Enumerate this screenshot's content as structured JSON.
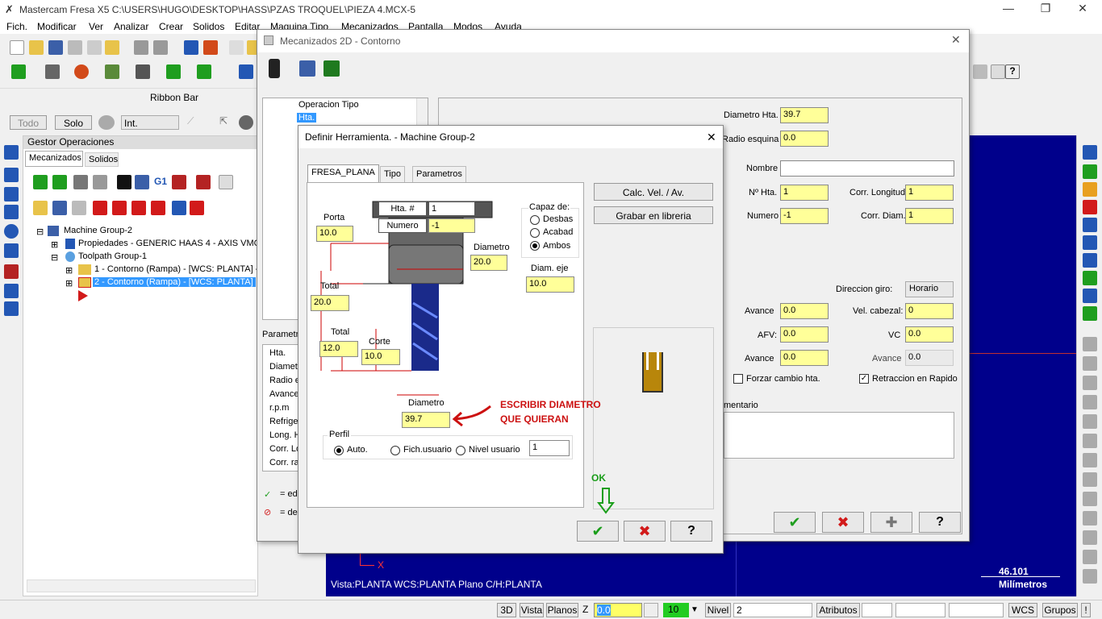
{
  "app": {
    "logo_glyph": "✗",
    "title": "Mastercam Fresa X5  C:\\USERS\\HUGO\\DESKTOP\\HASS\\PZAS TROQUEL\\PIEZA 4.MCX-5",
    "minimize": "—",
    "restore": "❐",
    "close": "✕"
  },
  "menu": [
    "Fich.",
    "Modificar",
    "Ver",
    "Analizar",
    "Crear",
    "Solidos",
    "Editar",
    "Maquina Tipo",
    "Mecanizados",
    "Pantalla",
    "Modos",
    "Ayuda"
  ],
  "ribbon_label": "Ribbon Bar",
  "filter": {
    "todo": "Todo",
    "solo": "Solo",
    "int": "Int."
  },
  "ops": {
    "header": "Gestor Operaciones",
    "tab1": "Mecanizados",
    "tab2": "Solidos",
    "g1": "G1",
    "tree": [
      "Machine Group-2",
      "Propiedades - GENERIC HAAS 4 - AXIS VMC",
      "Toolpath Group-1",
      "1 - Contorno  (Rampa) - [WCS: PLANTA] -",
      "2 - Contorno  (Rampa) - [WCS: PLANTA] -"
    ]
  },
  "viewport": {
    "x_label": "X",
    "status": "Vista:PLANTA   WCS:PLANTA   Plano C/H:PLANTA",
    "scale_value": "46.101",
    "scale_units": "Milímetros"
  },
  "statusbar": {
    "b3d": "3D",
    "vista": "Vista",
    "planos": "Planos",
    "z": "Z",
    "z_val": "0.0",
    "color": "10",
    "nivel": "Nivel",
    "nivel_val": "2",
    "atributos": "Atributos",
    "wcs": "WCS",
    "grupos": "Grupos",
    "bang": "!"
  },
  "contorno": {
    "title": "Mecanizados 2D - Contorno",
    "tree": [
      "Operacion Tipo",
      "Hta."
    ],
    "param_label": "Parametro",
    "param_items": [
      "Hta.",
      "Diametr",
      "Radio e",
      "Avance",
      "r.p.m",
      "Refriger",
      "Long. H",
      "Corr. Lo",
      "Corr. rad"
    ],
    "legend1": "= ed",
    "legend2": "= de",
    "diam_label": "Diametro Hta.",
    "diam_val": "39.7",
    "radio_label": "Radio esquina",
    "radio_val": "0.0",
    "nombre_label": "Nombre",
    "nhta_label": "Nº Hta.",
    "nhta_val": "1",
    "corrlong_label": "Corr. Longitud",
    "corrlong_val": "1",
    "numero_label": "Numero",
    "numero_val": "-1",
    "corrdiam_label": "Corr. Diam.",
    "corrdiam_val": "1",
    "dirgiro_label": "Direccion giro:",
    "dirgiro_val": "Horario",
    "avance_label": "Avance",
    "avance_val": "0.0",
    "velcab_label": "Vel. cabezal:",
    "velcab_val": "0",
    "afv_label": "AFV:",
    "afv_val": "0.0",
    "vc_label": "VC",
    "vc_val": "0.0",
    "avance2_label": "Avance",
    "avance2_val": "0.0",
    "avance3_label": "Avance",
    "avance3_val": "0.0",
    "forzar_label": "Forzar cambio hta.",
    "retraccion_label": "Retraccion en Rapido",
    "comentario_label": "mentario"
  },
  "herramienta": {
    "title": "Definir Herramienta. - Machine Group-2",
    "tabs": [
      "FRESA_PLANA",
      "Tipo",
      "Parametros"
    ],
    "hta_label": "Hta. #",
    "hta_val": "1",
    "numero_label": "Numero",
    "numero_val": "-1",
    "porta_label": "Porta",
    "porta_val": "10.0",
    "diametro_label": "Diametro",
    "diametro_val": "20.0",
    "diam_eje_label": "Diam. eje",
    "diam_eje_val": "10.0",
    "total_label": "Total",
    "total_val": "20.0",
    "total2_label": "Total",
    "total2_val": "12.0",
    "corte_label": "Corte",
    "corte_val": "10.0",
    "diam_bottom_label": "Diametro",
    "diam_bottom_val": "39.7",
    "capaz_label": "Capaz de:",
    "capaz": [
      "Desbas",
      "Acabad",
      "Ambos"
    ],
    "perfil_label": "Perfil",
    "perfil": [
      "Auto.",
      "Fich.usuario",
      "Nivel usuario"
    ],
    "perfil_val": "1",
    "calc_btn": "Calc. Vel. / Av.",
    "grabar_btn": "Grabar en libreria",
    "annotation": "ESCRIBIR DIAMETRO\nQUE QUIERAN",
    "annotation_line1": "ESCRIBIR DIAMETRO",
    "annotation_line2": "QUE QUIERAN",
    "ok_note": "OK",
    "check_glyph": "✔",
    "x_glyph": "✖",
    "help_glyph": "?",
    "plus_glyph": "✚"
  },
  "colors": {
    "viewport": "#00008b",
    "field_yellow": "#ffff99",
    "annotation_red": "#cc1111",
    "ok_green": "#1a9e1a",
    "tool_blue": "#1a2a8a"
  }
}
